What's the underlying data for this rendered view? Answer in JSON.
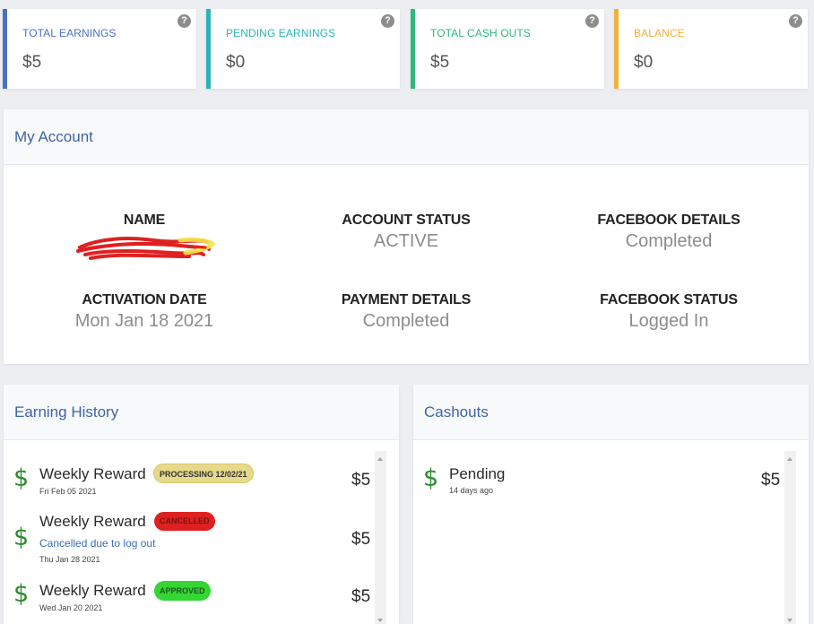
{
  "stats": {
    "total_earnings": {
      "label": "TOTAL EARNINGS",
      "value": "$5",
      "color": "#4a72c4"
    },
    "pending_earnings": {
      "label": "PENDING EARNINGS",
      "value": "$0",
      "color": "#2bb3b8"
    },
    "total_cash_outs": {
      "label": "TOTAL CASH OUTS",
      "value": "$5",
      "color": "#2eb87a"
    },
    "balance": {
      "label": "BALANCE",
      "value": "$0",
      "color": "#f3b13b"
    },
    "help_icon": "?"
  },
  "account": {
    "title": "My Account",
    "name_label": "NAME",
    "account_status_label": "ACCOUNT STATUS",
    "account_status_value": "ACTIVE",
    "facebook_details_label": "FACEBOOK DETAILS",
    "facebook_details_value": "Completed",
    "activation_date_label": "ACTIVATION DATE",
    "activation_date_value": "Mon Jan 18 2021",
    "payment_details_label": "PAYMENT DETAILS",
    "payment_details_value": "Completed",
    "facebook_status_label": "FACEBOOK STATUS",
    "facebook_status_value": "Logged In"
  },
  "earning_history": {
    "title": "Earning History",
    "items": [
      {
        "icon": "$",
        "title": "Weekly Reward",
        "badge": "PROCESSING 12/02/21",
        "date": "Fri Feb 05 2021",
        "amount": "$5"
      },
      {
        "icon": "$",
        "title": "Weekly Reward",
        "badge": "CANCELLED",
        "note": "Cancelled due to log out",
        "date": "Thu Jan 28 2021",
        "amount": "$5"
      },
      {
        "icon": "$",
        "title": "Weekly Reward",
        "badge": "APPROVED",
        "date": "Wed Jan 20 2021",
        "amount": "$5"
      }
    ]
  },
  "cashouts": {
    "title": "Cashouts",
    "items": [
      {
        "icon": "$",
        "title": "Pending",
        "date": "14 days ago",
        "amount": "$5"
      }
    ]
  }
}
